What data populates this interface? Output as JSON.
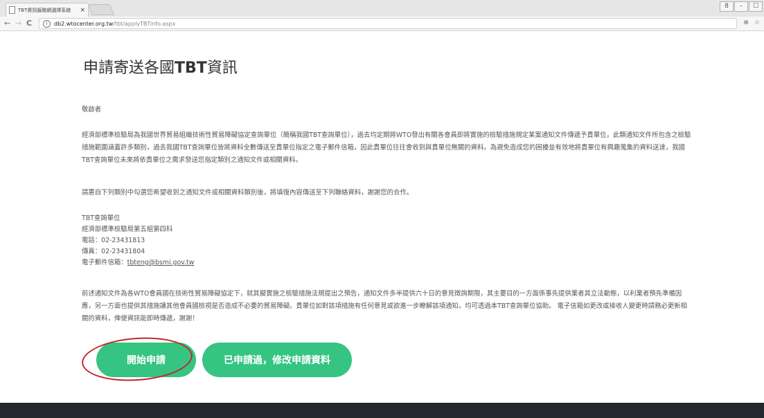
{
  "browser": {
    "tab_title": "TBT資訊服務網選擇系統",
    "tab_close": "×",
    "url_host": "db2.wtocenter.org.tw",
    "url_path": "/tbt/applyTBTinfo.aspx",
    "nav": {
      "back": "←",
      "forward": "→",
      "reload": "C"
    },
    "info_glyph": "i",
    "tools": {
      "zoom": "⊕",
      "star": "☆"
    },
    "window_controls": {
      "user": "8",
      "minimize": "–",
      "maximize": "☐"
    }
  },
  "page": {
    "title_prefix": "申請寄送各國",
    "title_bold": "TBT",
    "title_suffix": "資訊",
    "greeting": "敬啟者",
    "intro": "經濟部標準檢驗局為我國世界貿易組織技術性貿易障礙協定查詢單位（簡稱我國TBT查詢單位），過去均定期將WTO發出有關各會員即將實施的檢驗措施規定某案通知文件傳遞予貴單位，此類通知文件所包含之檢驗措施範圍涵蓋許多類別，過去我國TBT查詢單位皆將資料全數傳送至貴單位指定之電子郵件信箱，因此貴單位往往會收到與貴單位無關的資料。為避免造成您的困擾並有效地將貴單位有興趣蒐集的資料送達，我國TBT查詢單位未來將依貴單位之需求發送您指定類別之通知文件或相關資料。",
    "request": "請惠自下列類別中勾選您希望收到之通知文件或相關資料類別後，將填復內容傳送至下列聯絡資料，謝謝您的合作。",
    "contact": {
      "unit": "TBT查詢單位",
      "dept": "經濟部標準檢驗局第五組第四科",
      "phone": "電話：02-23431813",
      "fax": "傳真：02-23431804",
      "email_label": "電子郵件信箱：",
      "email": "tbteng@bsmi.gov.tw"
    },
    "notice": "前述通知文件為各WTO會員國在技術性貿易障礙協定下，就其擬實施之檢驗措施法規提出之預告，通知文件多半提供六十日的意見徵詢期限，其主要目的一方面係事先提供業者其立法動態，以利業者預先準備因應，另一方面也提供其措施讓其他會員國檢視是否造成不必要的貿易障礙。貴單位如對該項措施有任何意見或欲進一步瞭解該項通知，均可透過本TBT查詢單位協助。 電子信箱如更改或接收人變更時請務必更新相關的資料，俾便資訊能即時傳遞，謝謝！",
    "buttons": {
      "start": "開始申請",
      "modify": "已申請過，修改申請資料"
    },
    "colors": {
      "button_green": "#35c482",
      "annotation_red": "#c0262b",
      "footer_dark": "#25272e"
    }
  }
}
